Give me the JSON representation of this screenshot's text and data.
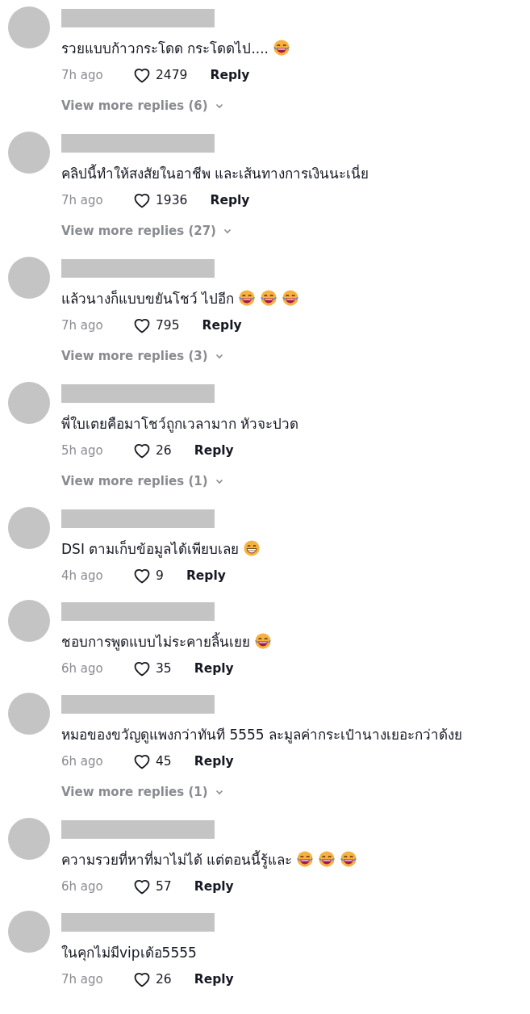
{
  "comments": [
    {
      "text": "รวยแบบก้าวกระโดด กระโดดไป....",
      "emojis": [
        {
          "kind": "tears_of_joy"
        }
      ],
      "time": "7h ago",
      "likes": "2479",
      "reply": "Reply",
      "more_replies": "View more replies (6)"
    },
    {
      "text": "คลิปนี้ทำให้สงสัยในอาชีพ และเส้นทางการเงินนะเนี่ย",
      "time": "7h ago",
      "likes": "1936",
      "reply": "Reply",
      "more_replies": "View more replies (27)"
    },
    {
      "text": "แล้วนางก็แบบขยันโชว์ ไปอีก",
      "emojis": [
        {
          "kind": "tears_of_joy"
        },
        {
          "kind": "tears_of_joy"
        },
        {
          "kind": "tears_of_joy"
        }
      ],
      "time": "7h ago",
      "likes": "795",
      "reply": "Reply",
      "more_replies": "View more replies (3)"
    },
    {
      "text": "พี่ใบเตยคือมาโชว์ถูกเวลามาก หัวจะปวด",
      "time": "5h ago",
      "likes": "26",
      "reply": "Reply",
      "more_replies": "View more replies (1)"
    },
    {
      "text": "DSI ตามเก็บข้อมูลได้เพียบเลย",
      "emojis": [
        {
          "kind": "grin"
        }
      ],
      "time": "4h ago",
      "likes": "9",
      "reply": "Reply"
    },
    {
      "text": "ชอบการพูดแบบไม่ระคายลิ้นเยย",
      "emojis": [
        {
          "kind": "tears_of_joy"
        }
      ],
      "time": "6h ago",
      "likes": "35",
      "reply": "Reply"
    },
    {
      "text": "หมอของขวัญดูแพงกว่าทันที 5555 ละมูลค่ากระเป๋านางเยอะกว่าด้งย",
      "time": "6h ago",
      "likes": "45",
      "reply": "Reply",
      "more_replies": "View more replies (1)"
    },
    {
      "text": "ความรวยที่หาที่มาไม่ได้ แต่ตอนนี้รู้และ",
      "emojis": [
        {
          "kind": "tears_of_joy"
        },
        {
          "kind": "tears_of_joy"
        },
        {
          "kind": "tears_of_joy"
        }
      ],
      "time": "6h ago",
      "likes": "57",
      "reply": "Reply"
    },
    {
      "text": "ในคุกไม่มีvipเด้อ5555",
      "time": "7h ago",
      "likes": "26",
      "reply": "Reply"
    }
  ]
}
